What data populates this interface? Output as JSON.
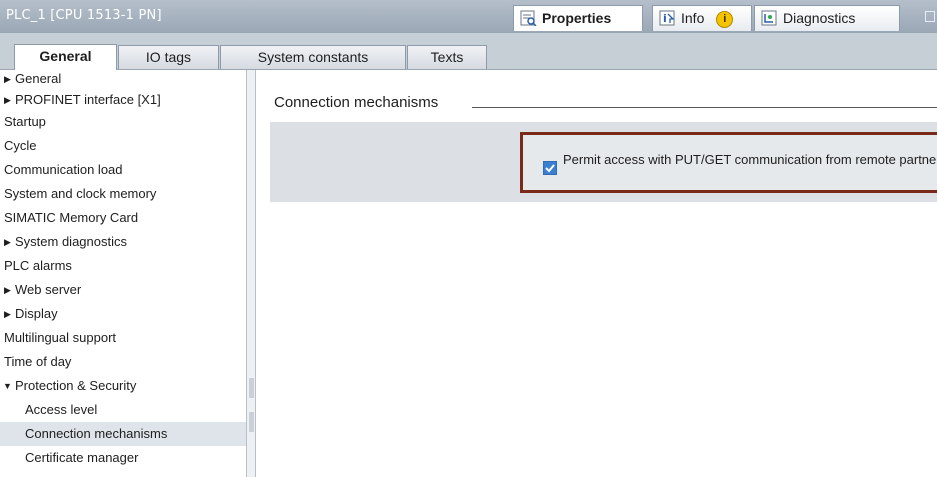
{
  "window": {
    "title": "PLC_1 [CPU 1513-1 PN]"
  },
  "panel_tabs": [
    {
      "label": "Properties",
      "icon": "properties-icon"
    },
    {
      "label": "Info",
      "icon": "info-icon"
    },
    {
      "label": "Diagnostics",
      "icon": "diagnostics-icon"
    }
  ],
  "info_badge": "i",
  "section_tabs": [
    "General",
    "IO tags",
    "System constants",
    "Texts"
  ],
  "nav": [
    {
      "label": "General",
      "expandable": true,
      "expanded": false
    },
    {
      "label": "PROFINET interface [X1]",
      "expandable": true,
      "expanded": false
    },
    {
      "label": "Startup"
    },
    {
      "label": "Cycle"
    },
    {
      "label": "Communication load"
    },
    {
      "label": "System and clock memory"
    },
    {
      "label": "SIMATIC Memory Card"
    },
    {
      "label": "System diagnostics",
      "expandable": true,
      "expanded": false
    },
    {
      "label": "PLC alarms"
    },
    {
      "label": "Web server",
      "expandable": true,
      "expanded": false
    },
    {
      "label": "Display",
      "expandable": true,
      "expanded": false
    },
    {
      "label": "Multilingual support"
    },
    {
      "label": "Time of day"
    },
    {
      "label": "Protection & Security",
      "expandable": true,
      "expanded": true
    },
    {
      "label": "Access level",
      "child": true
    },
    {
      "label": "Connection mechanisms",
      "child": true,
      "selected": true
    },
    {
      "label": "Certificate manager",
      "child": true
    }
  ],
  "content": {
    "section_title": "Connection mechanisms",
    "checkbox_label": "Permit access with PUT/GET communication from remote partner",
    "checkbox_checked": true
  },
  "colors": {
    "highlight_border": "#7a2a18",
    "titlebar": "#a8b3c0",
    "checkbox": "#3a7fd0"
  }
}
